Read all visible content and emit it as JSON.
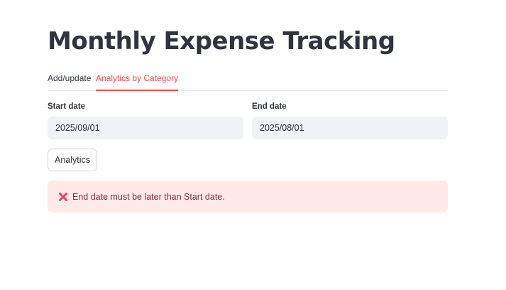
{
  "page": {
    "title": "Monthly Expense Tracking"
  },
  "tabs": [
    {
      "label": "Add/update",
      "active": false
    },
    {
      "label": "Analytics by Category",
      "active": true
    }
  ],
  "form": {
    "start_date": {
      "label": "Start date",
      "value": "2025/09/01"
    },
    "end_date": {
      "label": "End date",
      "value": "2025/08/01"
    },
    "analytics_button": "Analytics"
  },
  "alert": {
    "icon": "x-mark-icon",
    "message": "End date must be later than Start date."
  },
  "colors": {
    "accent": "#ff4b4b",
    "error_bg": "#ffe9e9",
    "error_text": "#7d353b"
  }
}
